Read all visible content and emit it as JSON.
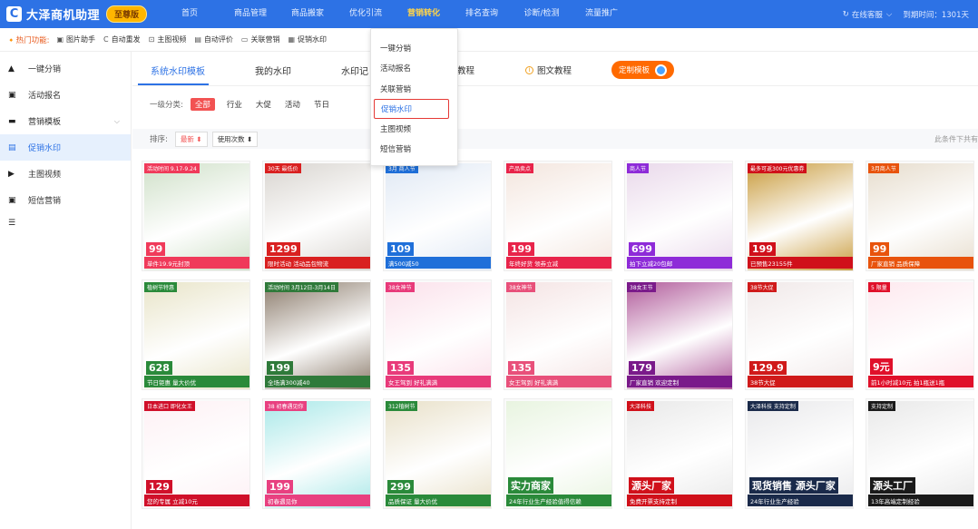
{
  "app": {
    "title": "大泽商机助理",
    "vip": "至尊版",
    "logo_icon": "logo-icon"
  },
  "nav": [
    {
      "label": "首页",
      "active": false
    },
    {
      "label": "商品管理",
      "active": false
    },
    {
      "label": "商品搬家",
      "active": false
    },
    {
      "label": "优化引流",
      "active": false
    },
    {
      "label": "营销转化",
      "active": true
    },
    {
      "label": "排名查询",
      "active": false
    },
    {
      "label": "诊断/检测",
      "active": false
    },
    {
      "label": "流量推广",
      "active": false
    }
  ],
  "top_right": {
    "service": "在线客服",
    "expire": "到期时间：1301天"
  },
  "hotbar": {
    "label": "热门功能:",
    "items": [
      "图片助手",
      "自动重发",
      "主图视频",
      "自动评价",
      "关联营销",
      "促销水印"
    ]
  },
  "sidebar": {
    "items": [
      {
        "label": "一键分销",
        "icon": "triangle-icon"
      },
      {
        "label": "活动报名",
        "icon": "calendar-icon"
      },
      {
        "label": "营销模板",
        "icon": "template-icon"
      },
      {
        "label": "促销水印",
        "icon": "watermark-icon"
      },
      {
        "label": "主图视频",
        "icon": "video-icon"
      },
      {
        "label": "短信营销",
        "icon": "sms-icon"
      }
    ],
    "collapse_icon": "menu-collapse-icon"
  },
  "tabs": {
    "items": [
      "系统水印模板",
      "我的水印",
      "水印记"
    ],
    "help_items": [
      "教程",
      "图文教程"
    ],
    "custom_button": "定制模板"
  },
  "category": {
    "label": "一级分类:",
    "items": [
      "全部",
      "行业",
      "大促",
      "活动",
      "节日"
    ]
  },
  "sort": {
    "label": "排序:",
    "buttons": [
      "最新",
      "使用次数"
    ],
    "right_text": "此条件下共有"
  },
  "dropdown": {
    "items": [
      "一键分销",
      "活动报名",
      "关联营销",
      "促销水印",
      "主图视频",
      "短信营销"
    ],
    "highlighted": "促销水印"
  },
  "cards": [
    [
      {
        "band": "单件19.9元封顶",
        "price": "99",
        "tag": "活动时间 9.17-9.24",
        "color": "#f03a5a",
        "bg": "#cfe0c8"
      },
      {
        "band": "限时活动 活动品包物流",
        "price": "1299",
        "tag": "30天 最低价",
        "color": "#d92020",
        "bg": "#d8d4cf"
      },
      {
        "band": "满500减50",
        "price": "109",
        "tag": "3月 商人节",
        "color": "#1f6fd9",
        "bg": "#dfe8f4"
      },
      {
        "band": "年终好货 领券立减",
        "price": "199",
        "tag": "产品卖点",
        "color": "#e8244a",
        "bg": "#f3e5dd"
      },
      {
        "band": "拍下立减20包邮",
        "price": "699",
        "tag": "商人节",
        "color": "#8e2bd8",
        "bg": "#e9d8ea"
      },
      {
        "band": "已预售23155件",
        "price": "199",
        "tag": "最多可返300元优惠券",
        "color": "#d0101a",
        "bg": "#c89a3a"
      },
      {
        "band": "厂家直销 品质保障",
        "price": "99",
        "tag": "3月商人节",
        "color": "#e8530c",
        "bg": "#e6dccc"
      }
    ],
    [
      {
        "band": "节日钜惠 量大价优",
        "price": "628",
        "tag": "植树节特惠",
        "color": "#2a8a3a",
        "bg": "#e8e4c8"
      },
      {
        "band": "全场满300减40",
        "price": "199",
        "tag": "活动时间 3月12日-3月14日",
        "color": "#2f7a3a",
        "bg": "#8a7a6a"
      },
      {
        "band": "女王驾到 好礼满满",
        "price": "135",
        "tag": "38女神节",
        "color": "#e83a7a",
        "bg": "#fbe0ea"
      },
      {
        "band": "女王驾到 好礼满满",
        "price": "135",
        "tag": "38女神节",
        "color": "#e8507a",
        "bg": "#f4e3e3"
      },
      {
        "band": "厂家直销 欢迎定制",
        "price": "179",
        "tag": "38女王节",
        "color": "#7a1a8a",
        "bg": "#b05a9a"
      },
      {
        "band": "38节大促",
        "price": "129.9",
        "tag": "38节大促",
        "color": "#d01a1a",
        "bg": "#f0e8e8"
      },
      {
        "band": "前1小时减10元 拍1瓶送1瓶",
        "price": "9元",
        "tag": "5 限量",
        "color": "#e0102a",
        "bg": "#fde8ee"
      }
    ],
    [
      {
        "band": "您的专属 立减10元",
        "price": "129",
        "tag": "日本进口 即化女王",
        "color": "#d0102a",
        "bg": "#fdf0f4"
      },
      {
        "band": "初春遇见你",
        "price": "199",
        "tag": "38 初春遇见你",
        "color": "#e84080",
        "bg": "#a8e8e8"
      },
      {
        "band": "品质保证 量大价优",
        "price": "299",
        "tag": "312植树节",
        "color": "#2a8a3a",
        "bg": "#e8e0c8"
      },
      {
        "band": "24年行业生产经验值得信赖",
        "price": "实力商家",
        "tag": "",
        "color": "#2a8a3a",
        "bg": "#e8f4e0"
      },
      {
        "band": "免费开票支持定制",
        "price": "源头厂家",
        "tag": "大泽科技",
        "color": "#d0101a",
        "bg": "#e8e8e8"
      },
      {
        "band": "24年行业生产经验",
        "price": "现货销售 源头厂家",
        "tag": "大泽科技 支持定制",
        "color": "#1a2a4a",
        "bg": "#e8e8ea"
      },
      {
        "band": "13年高端定制经验",
        "price": "源头工厂",
        "tag": "支持定制",
        "color": "#1a1a1a",
        "bg": "#e8e8e8"
      }
    ]
  ]
}
